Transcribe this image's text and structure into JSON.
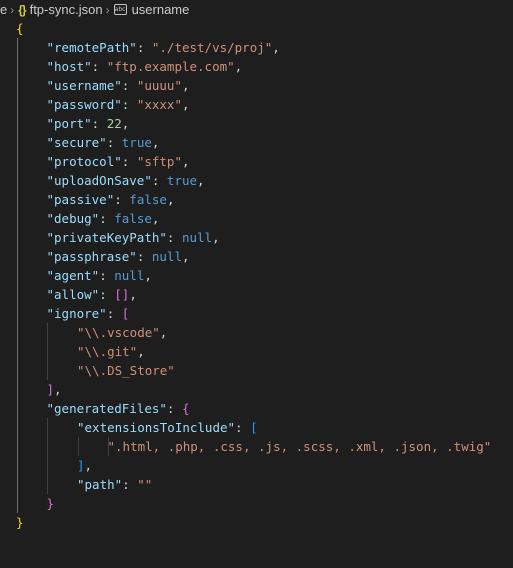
{
  "breadcrumb": {
    "prefix": "e",
    "file": "ftp-sync.json",
    "json_icon": "{}",
    "symbol_icon": "abc",
    "symbol": "username"
  },
  "code": {
    "open_brace": "{",
    "close_brace": "}",
    "entries": [
      {
        "key": "\"remotePath\"",
        "value": "\"./test/vs/proj\""
      },
      {
        "key": "\"host\"",
        "value": "\"ftp.example.com\""
      },
      {
        "key": "\"username\"",
        "value": "\"uuuu\""
      },
      {
        "key": "\"password\"",
        "value": "\"xxxx\""
      },
      {
        "key": "\"port\"",
        "value": "22"
      },
      {
        "key": "\"secure\"",
        "value": "true"
      },
      {
        "key": "\"protocol\"",
        "value": "\"sftp\""
      },
      {
        "key": "\"uploadOnSave\"",
        "value": "true"
      },
      {
        "key": "\"passive\"",
        "value": "false"
      },
      {
        "key": "\"debug\"",
        "value": "false"
      },
      {
        "key": "\"privateKeyPath\"",
        "value": "null"
      },
      {
        "key": "\"passphrase\"",
        "value": "null"
      },
      {
        "key": "\"agent\"",
        "value": "null"
      },
      {
        "key": "\"allow\"",
        "value": "[]"
      }
    ],
    "ignore": {
      "key": "\"ignore\"",
      "open": "[",
      "close": "]",
      "items": [
        "\"\\\\.vscode\"",
        "\"\\\\.git\"",
        "\"\\\\.DS_Store\""
      ]
    },
    "generated": {
      "key": "\"generatedFiles\"",
      "open": "{",
      "close": "}",
      "ext_key": "\"extensionsToInclude\"",
      "ext_open": "[",
      "ext_close": "]",
      "ext_value": "\".html, .php, .css, .js, .scss, .xml, .json, .twig\"",
      "path_key": "\"path\"",
      "path_value": "\"\""
    }
  },
  "colors": {
    "background": "#1e1e1e",
    "key": "#9cdcfe",
    "string": "#ce9178",
    "number": "#b5cea8",
    "keyword": "#569cd6",
    "bracket_level1": "#ffd700",
    "bracket_level2": "#da70d6",
    "bracket_level3": "#179fff"
  }
}
